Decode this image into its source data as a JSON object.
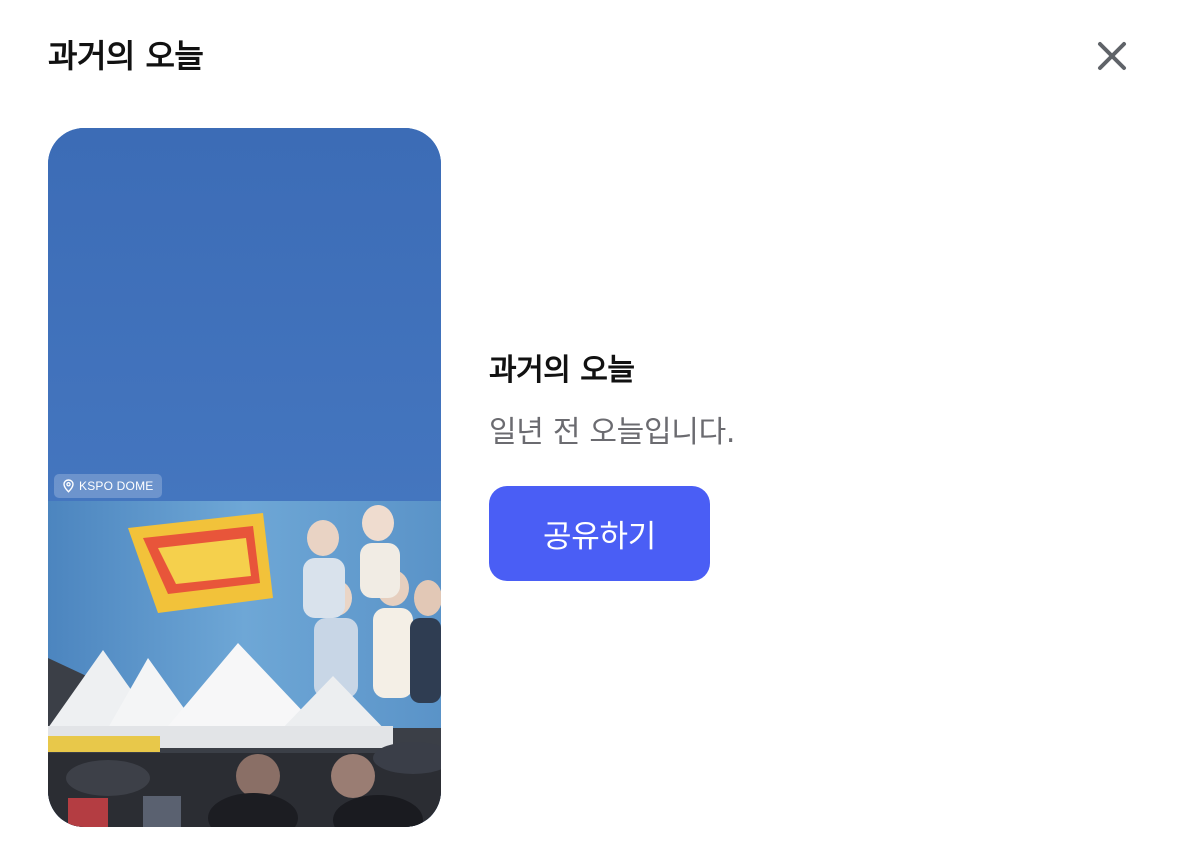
{
  "header": {
    "title": "과거의 오늘",
    "close_icon": "close-icon"
  },
  "photo": {
    "location_icon": "map-pin-icon",
    "location_label": "KSPO DOME"
  },
  "memory": {
    "title": "과거의 오늘",
    "subtitle": "일년 전 오늘입니다.",
    "share_label": "공유하기"
  },
  "colors": {
    "accent": "#4a5ef5",
    "title_text": "#111111",
    "subtitle_text": "#6b6b70",
    "close_icon": "#5f6368"
  }
}
